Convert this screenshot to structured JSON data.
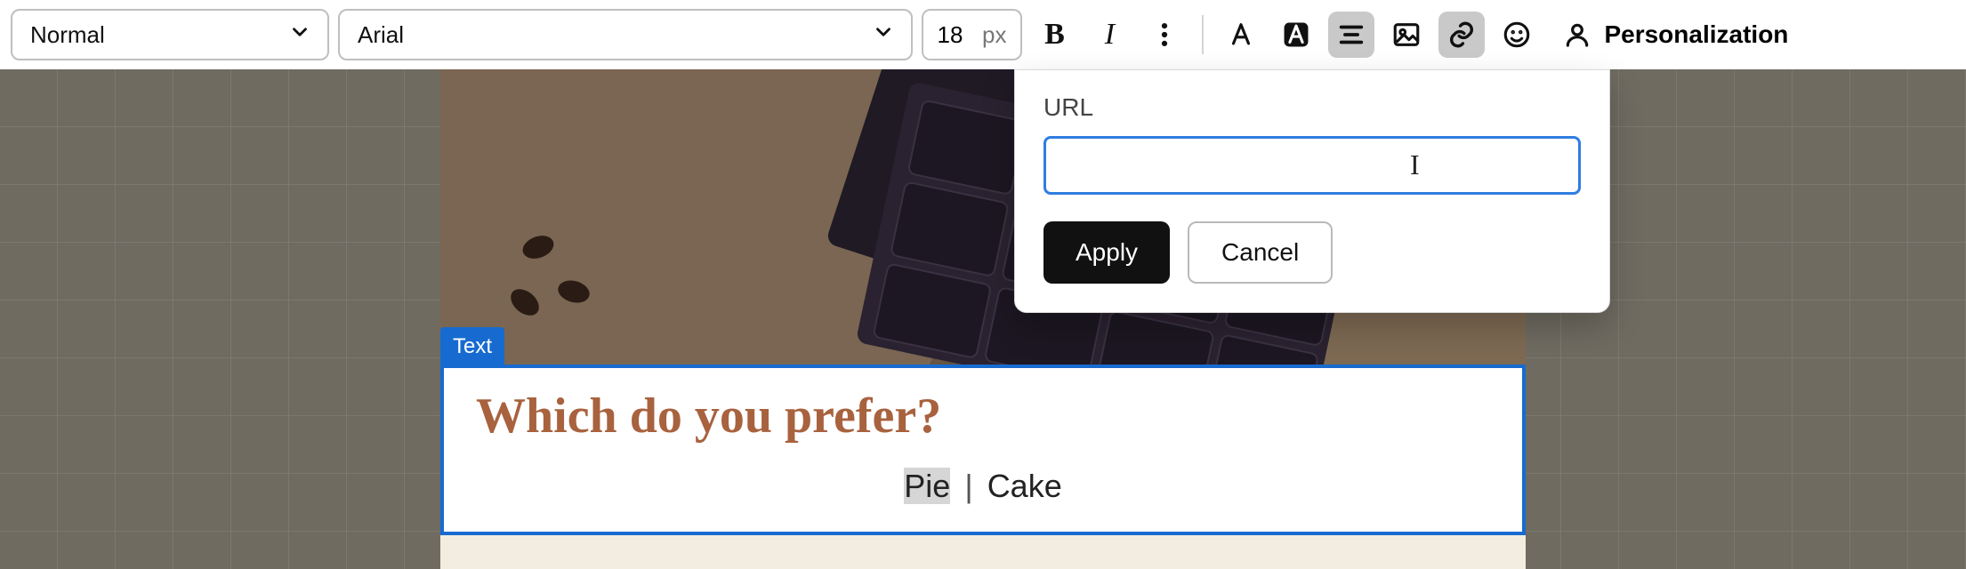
{
  "toolbar": {
    "paragraph_style": "Normal",
    "font_family": "Arial",
    "font_size": "18",
    "font_size_unit": "px",
    "personalization_label": "Personalization"
  },
  "link_popover": {
    "url_label": "URL",
    "url_value": "",
    "apply_label": "Apply",
    "cancel_label": "Cancel"
  },
  "editor": {
    "block_tag": "Text",
    "heading": "Which do you prefer?",
    "option_a": "Pie",
    "separator": "|",
    "option_b": "Cake"
  }
}
